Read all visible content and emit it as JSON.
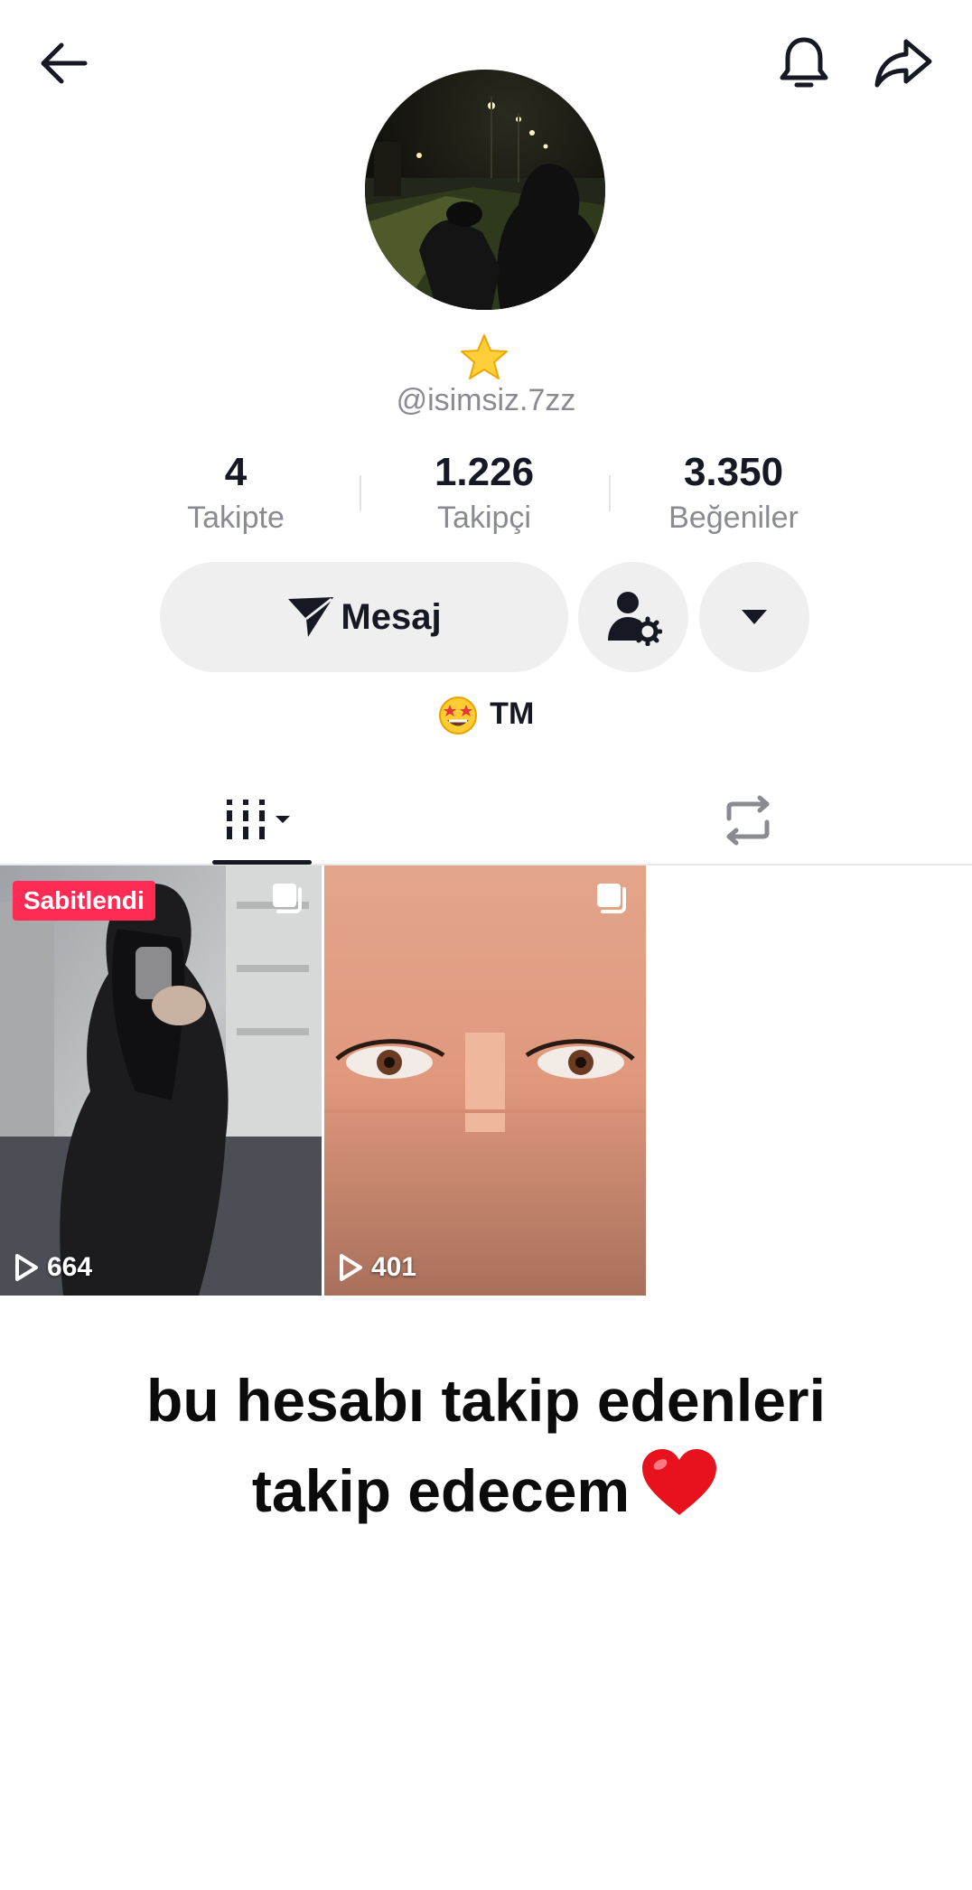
{
  "header": {
    "back_icon": "arrow-left-icon",
    "bell_icon": "bell-icon",
    "share_icon": "share-arrow-icon"
  },
  "profile": {
    "username": "@isimsiz.7zz",
    "badge_icon": "star-icon"
  },
  "stats": [
    {
      "value": "4",
      "label": "Takipte"
    },
    {
      "value": "1.226",
      "label": "Takipçi"
    },
    {
      "value": "3.350",
      "label": "Beğeniler"
    }
  ],
  "actions": {
    "message_label": "Mesaj",
    "message_icon": "send-icon",
    "friend_icon": "user-settings-icon",
    "more_icon": "caret-down-icon"
  },
  "bio": {
    "emoji": "star-struck-emoji",
    "text": "TM"
  },
  "tabs": [
    {
      "name": "videos",
      "icon": "grid-bars-icon",
      "active": true
    },
    {
      "name": "reposts",
      "icon": "repost-icon",
      "active": false
    }
  ],
  "videos": [
    {
      "pinned_label": "Sabitlendi",
      "views": "664"
    },
    {
      "pinned_label": "",
      "views": "401"
    }
  ],
  "caption": {
    "line1": "bu hesabı takip edenleri",
    "line2": "takip edecem"
  },
  "colors": {
    "accent": "#fe2c55",
    "secondary_text": "#8a8b91",
    "button_bg": "#efefef"
  }
}
